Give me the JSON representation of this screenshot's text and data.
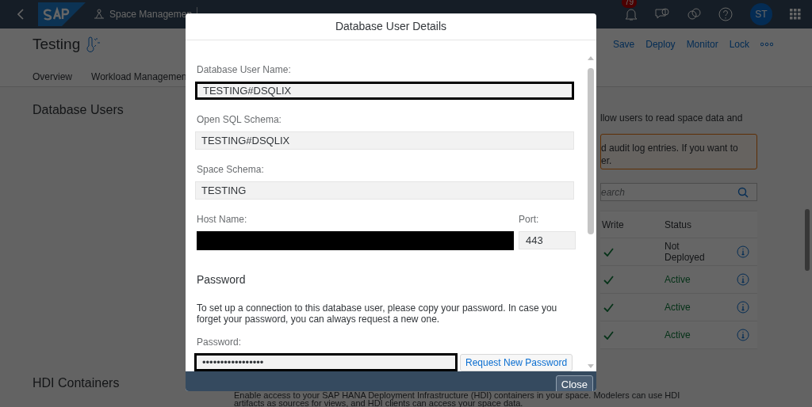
{
  "shell_bar": {
    "breadcrumb": [
      "Space Managemen"
    ],
    "notification_count": "79",
    "avatar": "ST"
  },
  "object_page": {
    "title": "Testing",
    "actions": [
      "Save",
      "Deploy",
      "Monitor",
      "Lock"
    ],
    "tabs": [
      "Overview",
      "Workload Managemen"
    ]
  },
  "database_users": {
    "title": "Database Users",
    "description": "llow users to read space data and",
    "warning_lines": [
      "d audit log entries. If you want to",
      "er."
    ],
    "search_placeholder": "earch",
    "columns": [
      "Write",
      "Status"
    ],
    "rows": [
      {
        "write": true,
        "status": "Not Deployed",
        "active": false
      },
      {
        "write": true,
        "status": "Active",
        "active": true
      },
      {
        "write": true,
        "status": "Active",
        "active": true
      },
      {
        "write": true,
        "status": "Active",
        "active": true
      }
    ]
  },
  "hdi_containers": {
    "title": "HDI Containers",
    "description_lines": [
      "Enable access to your SAP HANA Deployment Infrastructure (HDI) containers in your space. Modelers can use HDI",
      "artifacts as sources for views, and HDI clients can access your space data."
    ]
  },
  "dialog": {
    "title": "Database User Details",
    "fields": [
      {
        "label": "Database User Name:",
        "value": "TESTING#DSQLIX",
        "outlined": true
      },
      {
        "label": "Open SQL Schema:",
        "value": "TESTING#DSQLIX",
        "outlined": false
      },
      {
        "label": "Space Schema:",
        "value": "TESTING",
        "outlined": false
      }
    ],
    "host": {
      "label": "Host Name:",
      "redacted": true
    },
    "port": {
      "label": "Port:",
      "value": "443"
    },
    "password_section": {
      "heading": "Password",
      "text": "To set up a connection to this database user, please copy your password. In case you forget your password, you can always request a new one.",
      "label": "Password:",
      "value": "•••••••••••••••••",
      "outlined": true,
      "request_button": "Request New Password"
    },
    "close_button": "Close"
  }
}
